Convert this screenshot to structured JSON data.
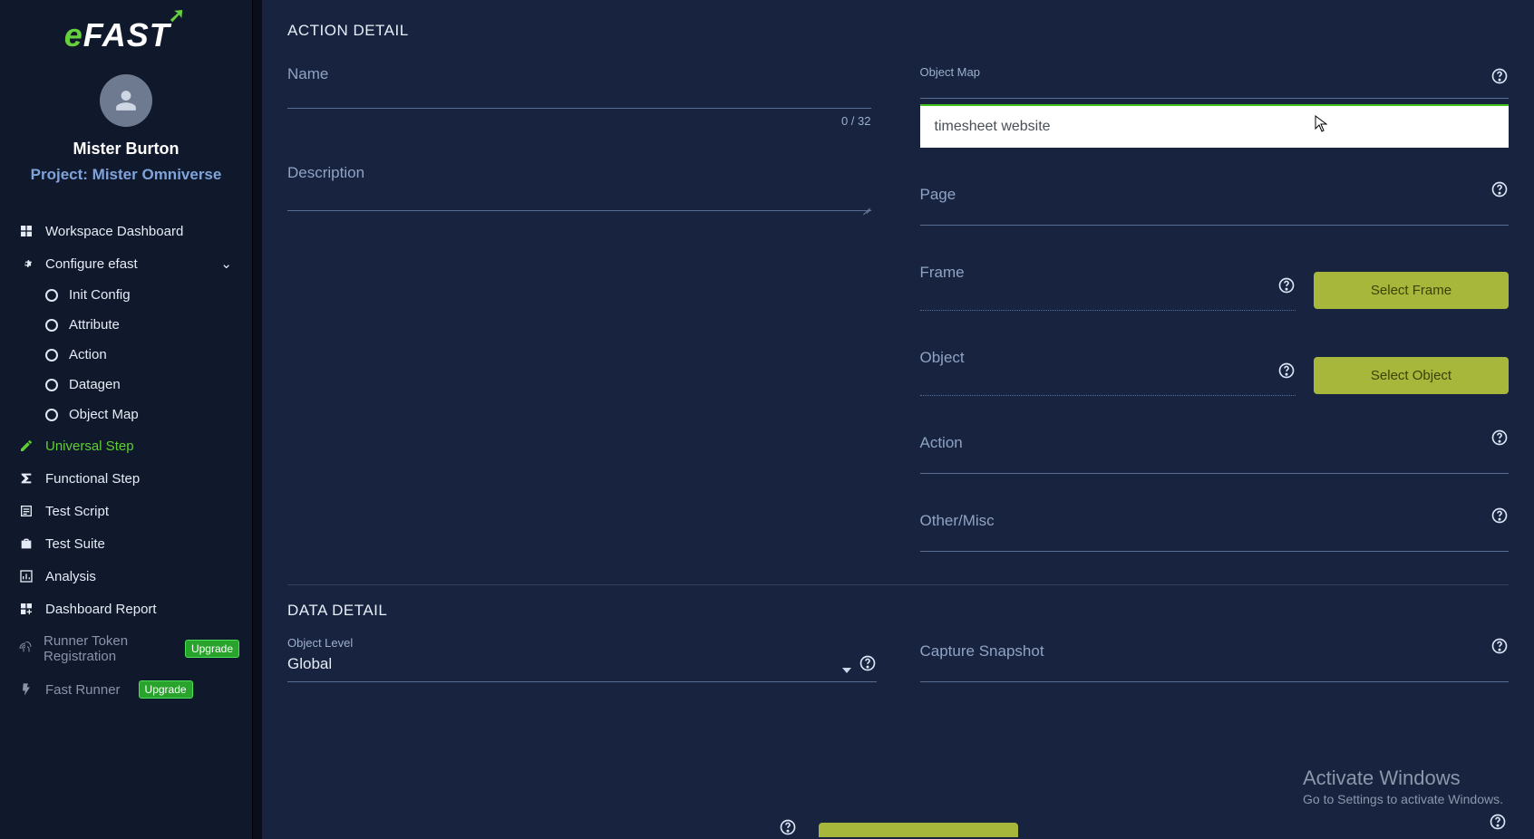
{
  "logo": {
    "prefix": "e",
    "rest": "FAST"
  },
  "user": {
    "name": "Mister Burton",
    "project_prefix": "Project: ",
    "project_name": "Mister Omniverse"
  },
  "sidebar": {
    "workspace": "Workspace Dashboard",
    "configure": "Configure efast",
    "subs": {
      "init": "Init Config",
      "attribute": "Attribute",
      "action": "Action",
      "datagen": "Datagen",
      "objectmap": "Object Map"
    },
    "universal": "Universal Step",
    "functional": "Functional Step",
    "testscript": "Test Script",
    "testsuite": "Test Suite",
    "analysis": "Analysis",
    "dashboardreport": "Dashboard Report",
    "runner_token": "Runner Token Registration",
    "fast_runner": "Fast Runner",
    "upgrade": "Upgrade"
  },
  "sections": {
    "action_detail": "ACTION DETAIL",
    "data_detail": "DATA DETAIL"
  },
  "form": {
    "name_label": "Name",
    "name_counter": "0 / 32",
    "description_label": "Description",
    "object_map_label": "Object Map",
    "object_map_option": "timesheet website",
    "page_label": "Page",
    "frame_label": "Frame",
    "select_frame_btn": "Select Frame",
    "object_label": "Object",
    "select_object_btn": "Select Object",
    "action_label": "Action",
    "other_label": "Other/Misc",
    "object_level_label": "Object Level",
    "object_level_value": "Global",
    "capture_snapshot_label": "Capture Snapshot"
  },
  "watermark": {
    "line1": "Activate Windows",
    "line2": "Go to Settings to activate Windows."
  }
}
